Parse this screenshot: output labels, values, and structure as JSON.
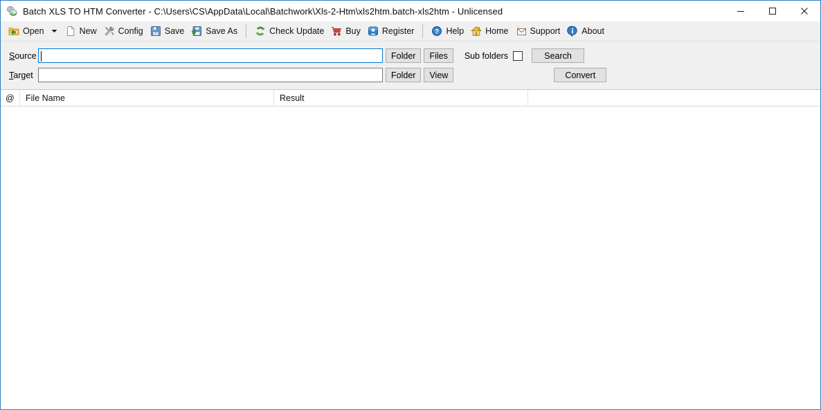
{
  "window": {
    "title": "Batch XLS TO HTM Converter - C:\\Users\\CS\\AppData\\Local\\Batchwork\\Xls-2-Htm\\xls2htm.batch-xls2htm - Unlicensed",
    "app_icon": "app-icon",
    "controls": {
      "minimize": "minimize-icon",
      "maximize": "maximize-icon",
      "close": "close-icon"
    },
    "border_color": "#2f7cc0"
  },
  "toolbar": {
    "items": [
      {
        "label": "Open",
        "icon": "open-folder-icon",
        "has_dropdown": true
      },
      {
        "label": "New",
        "icon": "new-document-icon",
        "has_dropdown": false
      },
      {
        "label": "Config",
        "icon": "config-tools-icon",
        "has_dropdown": false
      },
      {
        "label": "Save",
        "icon": "save-floppy-icon",
        "has_dropdown": false
      },
      {
        "label": "Save As",
        "icon": "save-as-floppy-icon",
        "has_dropdown": false
      },
      {
        "label": "Check Update",
        "icon": "refresh-update-icon",
        "has_dropdown": false
      },
      {
        "label": "Buy",
        "icon": "shopping-cart-icon",
        "has_dropdown": false
      },
      {
        "label": "Register",
        "icon": "register-key-icon",
        "has_dropdown": false
      },
      {
        "label": "Help",
        "icon": "help-question-icon",
        "has_dropdown": false
      },
      {
        "label": "Home",
        "icon": "home-house-icon",
        "has_dropdown": false
      },
      {
        "label": "Support",
        "icon": "support-envelope-icon",
        "has_dropdown": false
      },
      {
        "label": "About",
        "icon": "about-info-icon",
        "has_dropdown": false
      }
    ]
  },
  "panel": {
    "source": {
      "label_prefix": "S",
      "label_rest": "ource",
      "value": "",
      "placeholder": "",
      "folder_button": "Folder",
      "files_button": "Files",
      "focused": true
    },
    "target": {
      "label_prefix": "T",
      "label_rest": "arget",
      "value": "",
      "placeholder": "",
      "folder_button": "Folder",
      "view_button": "View",
      "focused": false
    },
    "sub_folders_label": "Sub folders",
    "sub_folders_checked": false,
    "search_button": "Search",
    "convert_button": "Convert"
  },
  "list": {
    "columns": [
      {
        "key": "at",
        "label": "@"
      },
      {
        "key": "file_name",
        "label": "File Name"
      },
      {
        "key": "result",
        "label": "Result"
      }
    ],
    "rows": []
  }
}
